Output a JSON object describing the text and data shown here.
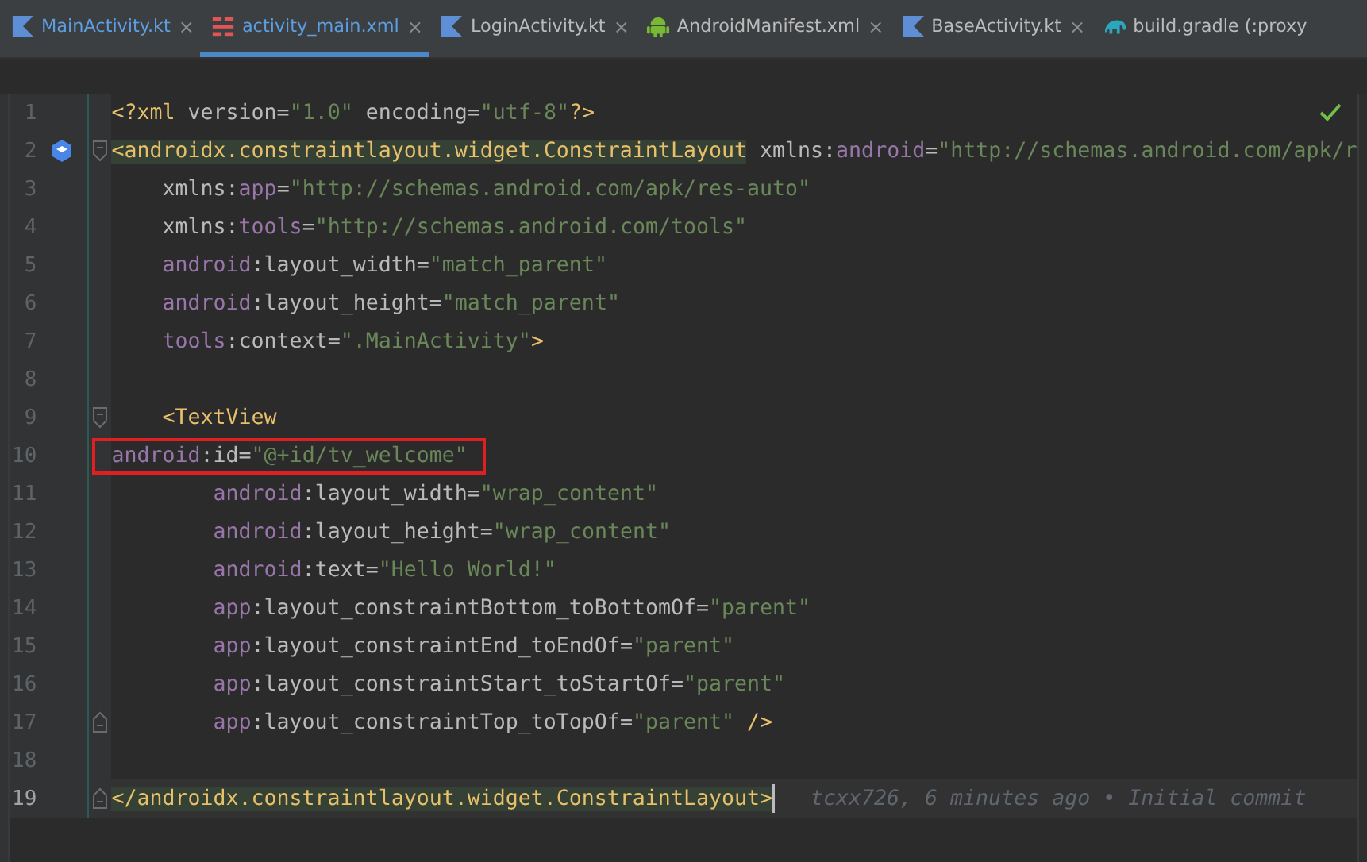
{
  "tabs": [
    {
      "label": "MainActivity.kt",
      "kind": "kotlin",
      "selected": false,
      "close": "×"
    },
    {
      "label": "activity_main.xml",
      "kind": "layout",
      "selected": true,
      "close": "×"
    },
    {
      "label": "LoginActivity.kt",
      "kind": "kotlin",
      "selected": false,
      "close": "×"
    },
    {
      "label": "AndroidManifest.xml",
      "kind": "android",
      "selected": false,
      "close": "×"
    },
    {
      "label": "BaseActivity.kt",
      "kind": "kotlin",
      "selected": false,
      "close": "×"
    },
    {
      "label": "build.gradle (:proxy",
      "kind": "gradle",
      "selected": false
    }
  ],
  "editor": {
    "inspection_ok": true,
    "lines": [
      {
        "number": "1",
        "current": false,
        "tokens": [
          {
            "kind": "tag",
            "text": "<?xml "
          },
          {
            "kind": "attr",
            "text": "version"
          },
          {
            "kind": "punct",
            "text": "="
          },
          {
            "kind": "value",
            "text": "\"1.0\""
          },
          {
            "kind": "attr",
            "text": " encoding"
          },
          {
            "kind": "punct",
            "text": "="
          },
          {
            "kind": "value",
            "text": "\"utf-8\""
          },
          {
            "kind": "tag",
            "text": "?>"
          }
        ]
      },
      {
        "number": "2",
        "current": false,
        "fold_start": true,
        "class_icon": true,
        "tokens": [
          {
            "kind": "tag",
            "text": "<androidx.constraintlayout.widget.ConstraintLayout",
            "matched": true
          },
          {
            "kind": "attr",
            "text": " xmlns"
          },
          {
            "kind": "punct",
            "text": ":"
          },
          {
            "kind": "ns",
            "text": "android"
          },
          {
            "kind": "punct",
            "text": "="
          },
          {
            "kind": "value",
            "text": "\"http://schemas.android.com/apk/r"
          }
        ]
      },
      {
        "number": "3",
        "current": false,
        "tokens": [
          {
            "kind": "attr",
            "text": "    xmlns"
          },
          {
            "kind": "punct",
            "text": ":"
          },
          {
            "kind": "ns",
            "text": "app"
          },
          {
            "kind": "punct",
            "text": "="
          },
          {
            "kind": "value",
            "text": "\"http://schemas.android.com/apk/res-auto\""
          }
        ]
      },
      {
        "number": "4",
        "current": false,
        "tokens": [
          {
            "kind": "attr",
            "text": "    xmlns"
          },
          {
            "kind": "punct",
            "text": ":"
          },
          {
            "kind": "ns",
            "text": "tools"
          },
          {
            "kind": "punct",
            "text": "="
          },
          {
            "kind": "value",
            "text": "\"http://schemas.android.com/tools\""
          }
        ]
      },
      {
        "number": "5",
        "current": false,
        "tokens": [
          {
            "kind": "ns",
            "text": "    android"
          },
          {
            "kind": "punct",
            "text": ":"
          },
          {
            "kind": "attr",
            "text": "layout_width"
          },
          {
            "kind": "punct",
            "text": "="
          },
          {
            "kind": "value",
            "text": "\"match_parent\""
          }
        ]
      },
      {
        "number": "6",
        "current": false,
        "tokens": [
          {
            "kind": "ns",
            "text": "    android"
          },
          {
            "kind": "punct",
            "text": ":"
          },
          {
            "kind": "attr",
            "text": "layout_height"
          },
          {
            "kind": "punct",
            "text": "="
          },
          {
            "kind": "value",
            "text": "\"match_parent\""
          }
        ]
      },
      {
        "number": "7",
        "current": false,
        "tokens": [
          {
            "kind": "ns",
            "text": "    tools"
          },
          {
            "kind": "punct",
            "text": ":"
          },
          {
            "kind": "attr",
            "text": "context"
          },
          {
            "kind": "punct",
            "text": "="
          },
          {
            "kind": "value",
            "text": "\".MainActivity\""
          },
          {
            "kind": "tag",
            "text": ">"
          }
        ]
      },
      {
        "number": "8",
        "current": false
      },
      {
        "number": "9",
        "current": false,
        "fold_start": true,
        "tokens": [
          {
            "kind": "tag",
            "text": "    <TextView"
          }
        ]
      },
      {
        "number": "10",
        "current": false,
        "boxed": true,
        "tokens": [
          {
            "kind": "ns",
            "text": "android"
          },
          {
            "kind": "punct",
            "text": ":"
          },
          {
            "kind": "attr",
            "text": "id"
          },
          {
            "kind": "punct",
            "text": "="
          },
          {
            "kind": "value",
            "text": "\"@+id/tv_welcome\""
          }
        ]
      },
      {
        "number": "11",
        "current": false,
        "tokens": [
          {
            "kind": "ns",
            "text": "        android"
          },
          {
            "kind": "punct",
            "text": ":"
          },
          {
            "kind": "attr",
            "text": "layout_width"
          },
          {
            "kind": "punct",
            "text": "="
          },
          {
            "kind": "value",
            "text": "\"wrap_content\""
          }
        ]
      },
      {
        "number": "12",
        "current": false,
        "tokens": [
          {
            "kind": "ns",
            "text": "        android"
          },
          {
            "kind": "punct",
            "text": ":"
          },
          {
            "kind": "attr",
            "text": "layout_height"
          },
          {
            "kind": "punct",
            "text": "="
          },
          {
            "kind": "value",
            "text": "\"wrap_content\""
          }
        ]
      },
      {
        "number": "13",
        "current": false,
        "tokens": [
          {
            "kind": "ns",
            "text": "        android"
          },
          {
            "kind": "punct",
            "text": ":"
          },
          {
            "kind": "attr",
            "text": "text"
          },
          {
            "kind": "punct",
            "text": "="
          },
          {
            "kind": "value",
            "text": "\"Hello World!\""
          }
        ]
      },
      {
        "number": "14",
        "current": false,
        "tokens": [
          {
            "kind": "ns",
            "text": "        app"
          },
          {
            "kind": "punct",
            "text": ":"
          },
          {
            "kind": "attr",
            "text": "layout_constraintBottom_toBottomOf"
          },
          {
            "kind": "punct",
            "text": "="
          },
          {
            "kind": "value",
            "text": "\"parent\""
          }
        ]
      },
      {
        "number": "15",
        "current": false,
        "tokens": [
          {
            "kind": "ns",
            "text": "        app"
          },
          {
            "kind": "punct",
            "text": ":"
          },
          {
            "kind": "attr",
            "text": "layout_constraintEnd_toEndOf"
          },
          {
            "kind": "punct",
            "text": "="
          },
          {
            "kind": "value",
            "text": "\"parent\""
          }
        ]
      },
      {
        "number": "16",
        "current": false,
        "tokens": [
          {
            "kind": "ns",
            "text": "        app"
          },
          {
            "kind": "punct",
            "text": ":"
          },
          {
            "kind": "attr",
            "text": "layout_constraintStart_toStartOf"
          },
          {
            "kind": "punct",
            "text": "="
          },
          {
            "kind": "value",
            "text": "\"parent\""
          }
        ]
      },
      {
        "number": "17",
        "current": false,
        "fold_end": true,
        "tokens": [
          {
            "kind": "ns",
            "text": "        app"
          },
          {
            "kind": "punct",
            "text": ":"
          },
          {
            "kind": "attr",
            "text": "layout_constraintTop_toTopOf"
          },
          {
            "kind": "punct",
            "text": "="
          },
          {
            "kind": "value",
            "text": "\"parent\""
          },
          {
            "kind": "tag",
            "text": " />"
          }
        ]
      },
      {
        "number": "18",
        "current": false
      },
      {
        "number": "19",
        "current": true,
        "fold_end": true,
        "blame": "tcxx726, 6 minutes ago • Initial commit",
        "tokens": [
          {
            "kind": "tag",
            "text": "</androidx.constraintlayout.widget.ConstraintLayout>",
            "matched": true
          }
        ]
      }
    ]
  }
}
